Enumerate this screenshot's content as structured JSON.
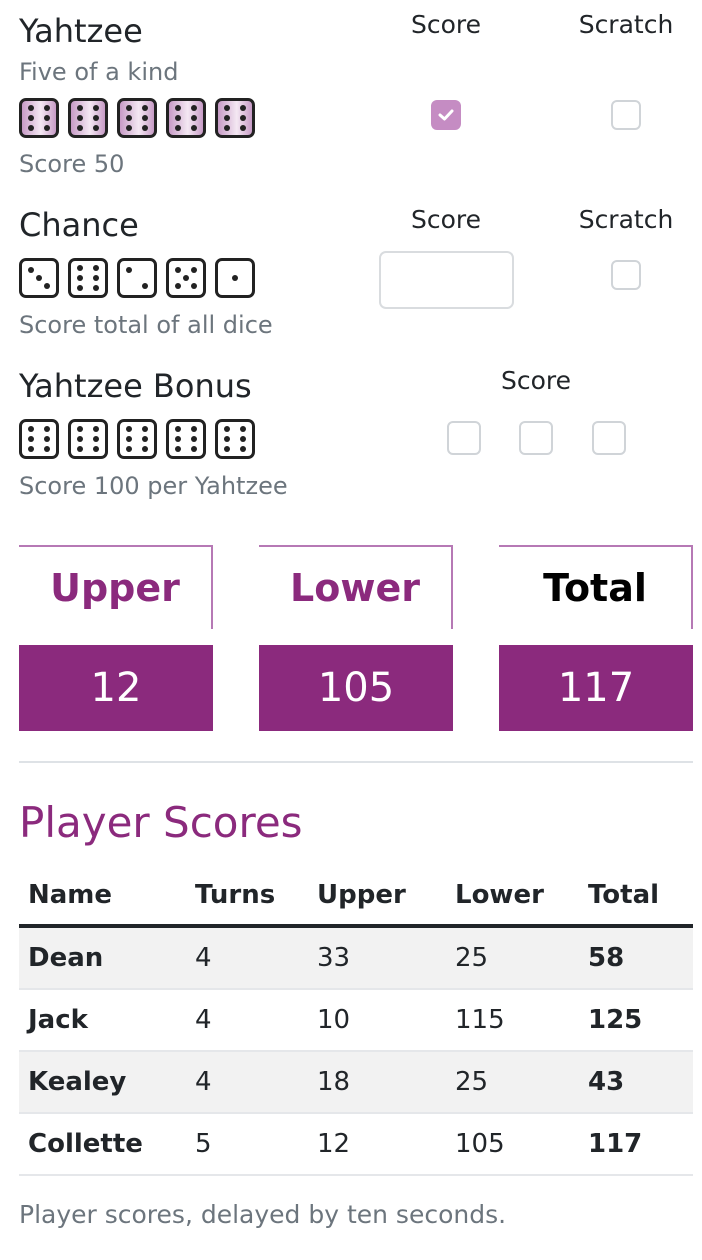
{
  "categories": [
    {
      "title": "Yahtzee",
      "subtitle": "Five of a kind",
      "dice": [
        6,
        6,
        6,
        6,
        6
      ],
      "held": true,
      "score_text": "Score 50",
      "score_header": "Score",
      "scratch_header": "Scratch",
      "score_checked": true,
      "scratch_checked": false
    },
    {
      "title": "Chance",
      "dice": [
        3,
        6,
        2,
        5,
        1
      ],
      "held": false,
      "description": "Score total of all dice",
      "score_header": "Score",
      "scratch_header": "Scratch",
      "score_value": "",
      "scratch_checked": false
    },
    {
      "title": "Yahtzee Bonus",
      "dice": [
        6,
        6,
        6,
        6,
        6
      ],
      "held": false,
      "description": "Score 100 per Yahtzee",
      "score_header": "Score",
      "bonus_checks": [
        false,
        false,
        false
      ]
    }
  ],
  "totals": {
    "upper_label": "Upper",
    "upper_value": "12",
    "lower_label": "Lower",
    "lower_value": "105",
    "total_label": "Total",
    "total_value": "117",
    "accent_color": "#8b2a7d"
  },
  "player_scores": {
    "title": "Player Scores",
    "columns": [
      "Name",
      "Turns",
      "Upper",
      "Lower",
      "Total"
    ],
    "rows": [
      {
        "name": "Dean",
        "turns": "4",
        "upper": "33",
        "lower": "25",
        "total": "58"
      },
      {
        "name": "Jack",
        "turns": "4",
        "upper": "10",
        "lower": "115",
        "total": "125"
      },
      {
        "name": "Kealey",
        "turns": "4",
        "upper": "18",
        "lower": "25",
        "total": "43"
      },
      {
        "name": "Collette",
        "turns": "5",
        "upper": "12",
        "lower": "105",
        "total": "117"
      }
    ],
    "note": "Player scores, delayed by ten seconds."
  }
}
